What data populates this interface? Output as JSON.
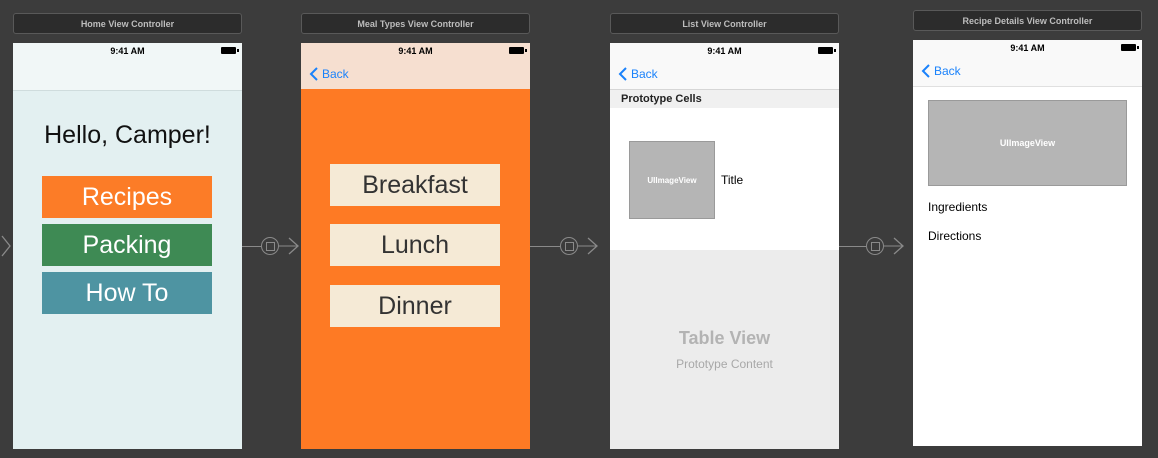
{
  "status_time": "9:41 AM",
  "scenes": {
    "home": {
      "title": "Home View Controller",
      "greeting": "Hello, Camper!",
      "buttons": [
        "Recipes",
        "Packing",
        "How To"
      ]
    },
    "meal_types": {
      "title": "Meal Types View Controller",
      "back": "Back",
      "buttons": [
        "Breakfast",
        "Lunch",
        "Dinner"
      ]
    },
    "list": {
      "title": "List View Controller",
      "back": "Back",
      "section_header": "Prototype Cells",
      "cell_image": "UIImageView",
      "cell_title": "Title",
      "table_title": "Table View",
      "table_subtitle": "Prototype Content"
    },
    "recipe_details": {
      "title": "Recipe Details View Controller",
      "back": "Back",
      "image": "UIImageView",
      "ingredients": "Ingredients",
      "directions": "Directions"
    }
  },
  "colors": {
    "recipes": "#fc7c27",
    "packing": "#3e8a54",
    "howto": "#4e94a2",
    "meal_bg": "#fe7a24",
    "meal_btn": "#f5ead6",
    "home_bg": "#e3f0f1",
    "link": "#1a82fb"
  },
  "icons": [
    "segue-icon",
    "chevron-left-icon",
    "battery-icon"
  ]
}
